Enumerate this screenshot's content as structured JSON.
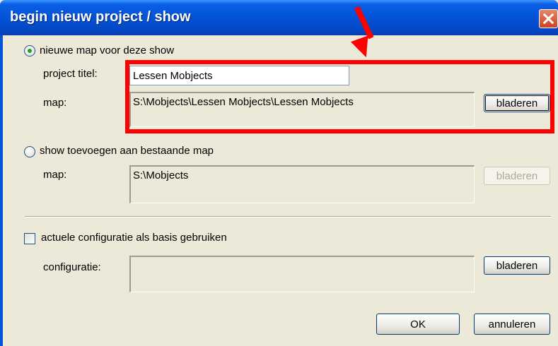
{
  "window": {
    "title": "begin nieuw project / show"
  },
  "new_folder": {
    "label": "nieuwe map voor deze show",
    "selected": true,
    "title_label": "project titel:",
    "title_value": "Lessen Mobjects",
    "map_label": "map:",
    "map_value": "S:\\Mobjects\\Lessen Mobjects\\Lessen Mobjects",
    "browse_label": "bladeren"
  },
  "existing_folder": {
    "label": "show toevoegen aan bestaande map",
    "selected": false,
    "map_label": "map:",
    "map_value": "S:\\Mobjects",
    "browse_label": "bladeren"
  },
  "configuration": {
    "checkbox_label": "actuele configuratie als basis gebruiken",
    "checked": false,
    "config_label": "configuratie:",
    "config_value": "",
    "browse_label": "bladeren"
  },
  "footer": {
    "ok_label": "OK",
    "cancel_label": "annuleren"
  },
  "annotation": {
    "color": "#ff0000"
  }
}
